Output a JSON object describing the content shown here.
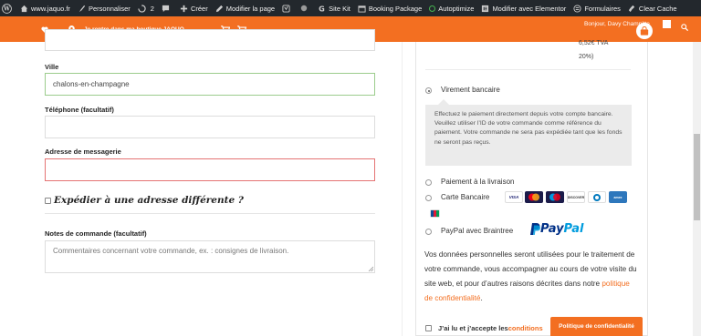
{
  "admin_bar": {
    "site": "www.jaquo.fr",
    "customize": "Personnaliser",
    "updates": "2",
    "new": "Créer",
    "edit_page": "Modifier la page",
    "site_kit": "Site Kit",
    "booking": "Booking Package",
    "autoptimize": "Autoptimize",
    "elementor": "Modifier avec Elementor",
    "forms": "Formulaires",
    "clear_cache": "Clear Cache"
  },
  "top_nav": {
    "shop_link": "Je rentre dans ma boutique JAQUO",
    "greeting": "Bonjour, Davy Champitte"
  },
  "form": {
    "city_label": "Ville",
    "city_value": "chalons-en-champagne",
    "phone_label": "Téléphone (facultatif)",
    "phone_value": "",
    "email_label": "Adresse de messagerie",
    "email_value": "",
    "ship_other_label": "Expédier à une adresse différente ?",
    "notes_label": "Notes de commande (facultatif)",
    "notes_placeholder": "Commentaires concernant votre commande, ex. : consignes de livraison."
  },
  "payment": {
    "tva_line1": "6,52€ TVA",
    "tva_line2": "20%)",
    "bank_transfer": "Virement bancaire",
    "bank_description": "Effectuez le paiement directement depuis votre compte bancaire. Veuillez utiliser l’ID de votre commande comme référence du paiement. Votre commande ne sera pas expédiée tant que les fonds ne seront pas reçus.",
    "cod": "Paiement à la livraison",
    "card": "Carte Bancaire",
    "card_brands": [
      "VISA",
      "mastercard",
      "maestro",
      "DISCOVER",
      "diners",
      "amex",
      "JCB"
    ],
    "paypal": "PayPal avec Braintree",
    "paypal_logo": "PayPal",
    "privacy_text": "Vos données personnelles seront utilisées pour le traitement de votre commande, vous accompagner au cours de votre visite du site web, et pour d’autres raisons décrites dans notre ",
    "privacy_link": "politique de confidentialité",
    "privacy_end": ".",
    "terms_text": "J’ai lu et j’accepte les ",
    "terms_link": "conditions"
  },
  "privacy_button": "Politique de confidentialité",
  "colors": {
    "accent": "#f36f21",
    "admin_bar": "#23282d",
    "paypal_dark": "#003087",
    "paypal_light": "#009cde"
  }
}
